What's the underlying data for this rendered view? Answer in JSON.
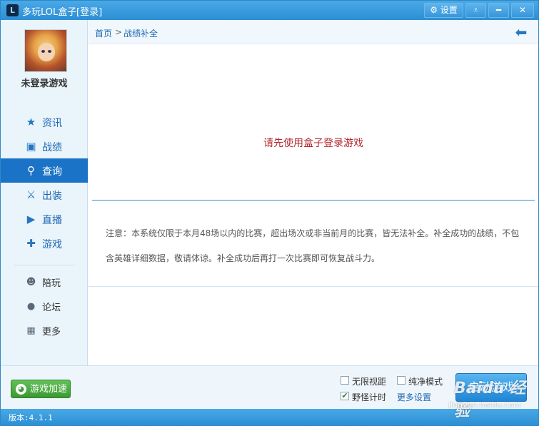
{
  "window": {
    "title": "多玩LOL盒子",
    "login_link": "[登录]",
    "settings_label": "设置",
    "settings_icon": "gear-icon",
    "menu_icon": "dropdown-menu-icon",
    "minimize_icon": "minimize-icon",
    "close_icon": "close-icon"
  },
  "sidebar": {
    "username": "未登录游戏",
    "items": [
      {
        "label": "资讯",
        "icon": "star-icon",
        "glyph": "★"
      },
      {
        "label": "战绩",
        "icon": "record-icon",
        "glyph": "▣"
      },
      {
        "label": "查询",
        "icon": "search-icon",
        "glyph": "⚲"
      },
      {
        "label": "出装",
        "icon": "equipment-icon",
        "glyph": "⚔"
      },
      {
        "label": "直播",
        "icon": "play-icon",
        "glyph": "▶"
      },
      {
        "label": "游戏",
        "icon": "gamepad-icon",
        "glyph": "✚"
      },
      {
        "label": "陪玩",
        "icon": "users-icon",
        "glyph": "☻"
      },
      {
        "label": "论坛",
        "icon": "chat-bubble-icon",
        "glyph": "●"
      },
      {
        "label": "更多",
        "icon": "grid-icon",
        "glyph": "▦"
      }
    ],
    "active_index": 2
  },
  "breadcrumb": {
    "home": "首页",
    "separator": ">",
    "current": "战绩补全",
    "back_icon": "back-arrow-icon"
  },
  "content": {
    "login_prompt": "请先使用盒子登录游戏",
    "notice_line1": "注意：本系统仅限于本月48场以内的比赛，超出场次或非当前月的比赛，皆无法补全。补全成功的战绩，不包",
    "notice_line2": "含英雄详细数据，敬请体谅。补全成功后再打一次比赛即可恢复战斗力。"
  },
  "bottom": {
    "speed_button": "游戏加速",
    "options": [
      {
        "label": "无限视距",
        "checked": false
      },
      {
        "label": "纯净模式",
        "checked": false
      },
      {
        "label": "野怪计时",
        "checked": true
      }
    ],
    "more_settings": "更多设置",
    "start_button": "启动游戏"
  },
  "status": {
    "version": "版本:4.1.1"
  },
  "watermark": {
    "logo": "Baidu 经验",
    "url": "jingyan.baidu.com"
  },
  "colors": {
    "accent": "#2b8fd4",
    "active_nav": "#1a73c6",
    "prompt_red": "#b3282d",
    "speed_green": "#3a9a32"
  }
}
